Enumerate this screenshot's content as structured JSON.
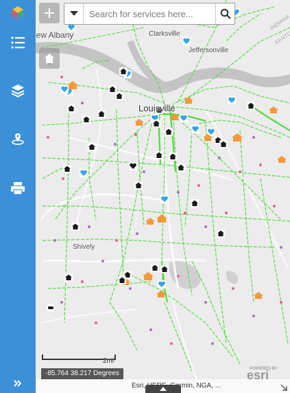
{
  "search": {
    "placeholder": "Search for services here..."
  },
  "places": {
    "new_albany": "New Albany",
    "clarksville": "Clarksville",
    "jeffersonville": "Jeffersonville",
    "louisville": "Louisville",
    "shively": "Shively",
    "indiana": "INDIANA",
    "kentucky": "KENTUCKY"
  },
  "scale": {
    "label": "2mi"
  },
  "coordinates": {
    "text": "-85.764 38.217 Degrees"
  },
  "attribution": {
    "text": "Esri, HERE, Garmin, NGA, ...",
    "powered_by": "POWERED BY",
    "logo": "esri"
  },
  "colors": {
    "sidebar": "#3c90d8",
    "road_network": "#52d93f",
    "river": "#bdbdbd",
    "school": "#f29a3a",
    "health": "#35a4e8",
    "shelter": "#1a1a1a",
    "dot_purple": "#9c77c2",
    "dot_pink": "#d96a8e"
  },
  "sidebar": {
    "items": [
      {
        "icon": "app-logo-icon"
      },
      {
        "icon": "layer-list-icon"
      },
      {
        "icon": "layers-icon"
      },
      {
        "icon": "location-icon"
      },
      {
        "icon": "print-icon"
      }
    ]
  }
}
